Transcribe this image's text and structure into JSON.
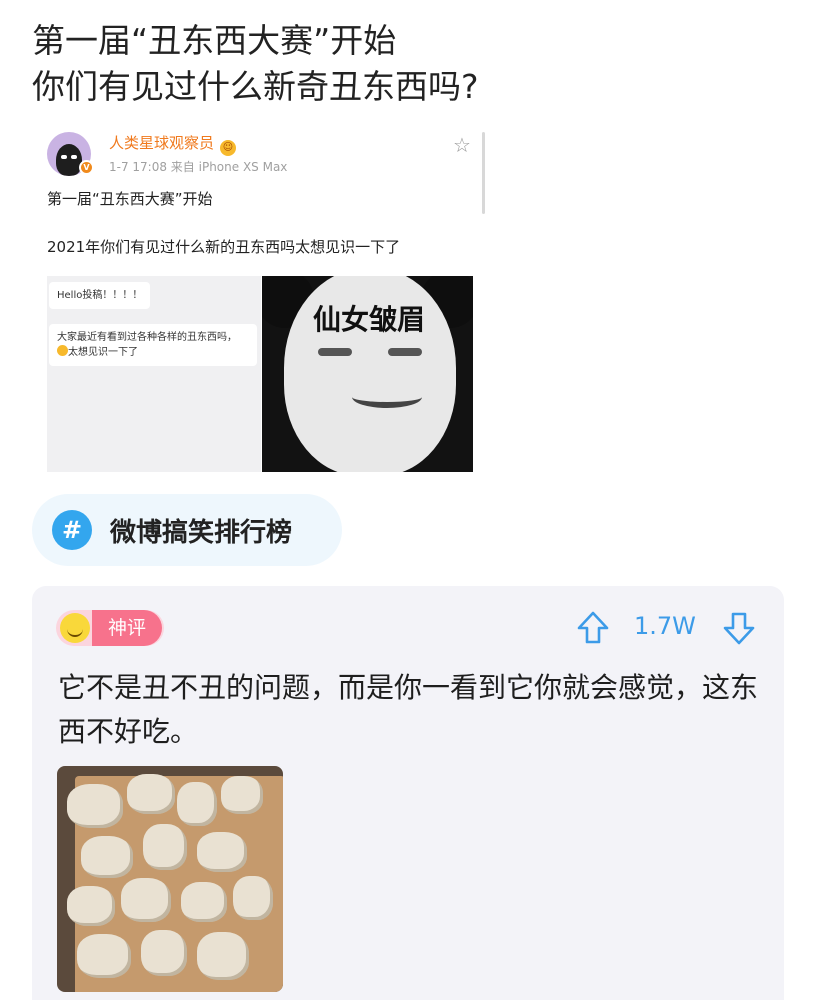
{
  "post": {
    "title_line1": "第一届“丑东西大赛”开始",
    "title_line2": "你们有见过什么新奇丑东西吗?"
  },
  "screenshot": {
    "username": "人类星球观察员",
    "meta": "1-7 17:08  来自 iPhone XS Max",
    "text1": "第一届“丑东西大赛”开始",
    "text2": "2021年你们有见过什么新的丑东西吗太想见识一下了",
    "chat_bubble1": "Hello投稿！！！！",
    "chat_bubble2_a": "大家最近有看到过各种各样的丑东西吗，",
    "chat_bubble2_b": "太想见识一下了",
    "meme_text": "仙女皱眉"
  },
  "topic": {
    "label": "微博搞笑排行榜"
  },
  "comment": {
    "badge": "神评",
    "count": "1.7W",
    "text": "它不是丑不丑的问题，而是你一看到它你就会感觉，这东西不好吃。"
  },
  "colors": {
    "accent_blue": "#3c9be8",
    "badge_pink": "#f7728c",
    "username_orange": "#f07a1e",
    "topic_bg": "#eef7fd",
    "card_bg": "#f3f3f8"
  },
  "icons": [
    "verified-badge-icon",
    "star-icon",
    "hash-icon",
    "upvote-arrow-icon",
    "downvote-arrow-icon",
    "smiley-icon"
  ]
}
